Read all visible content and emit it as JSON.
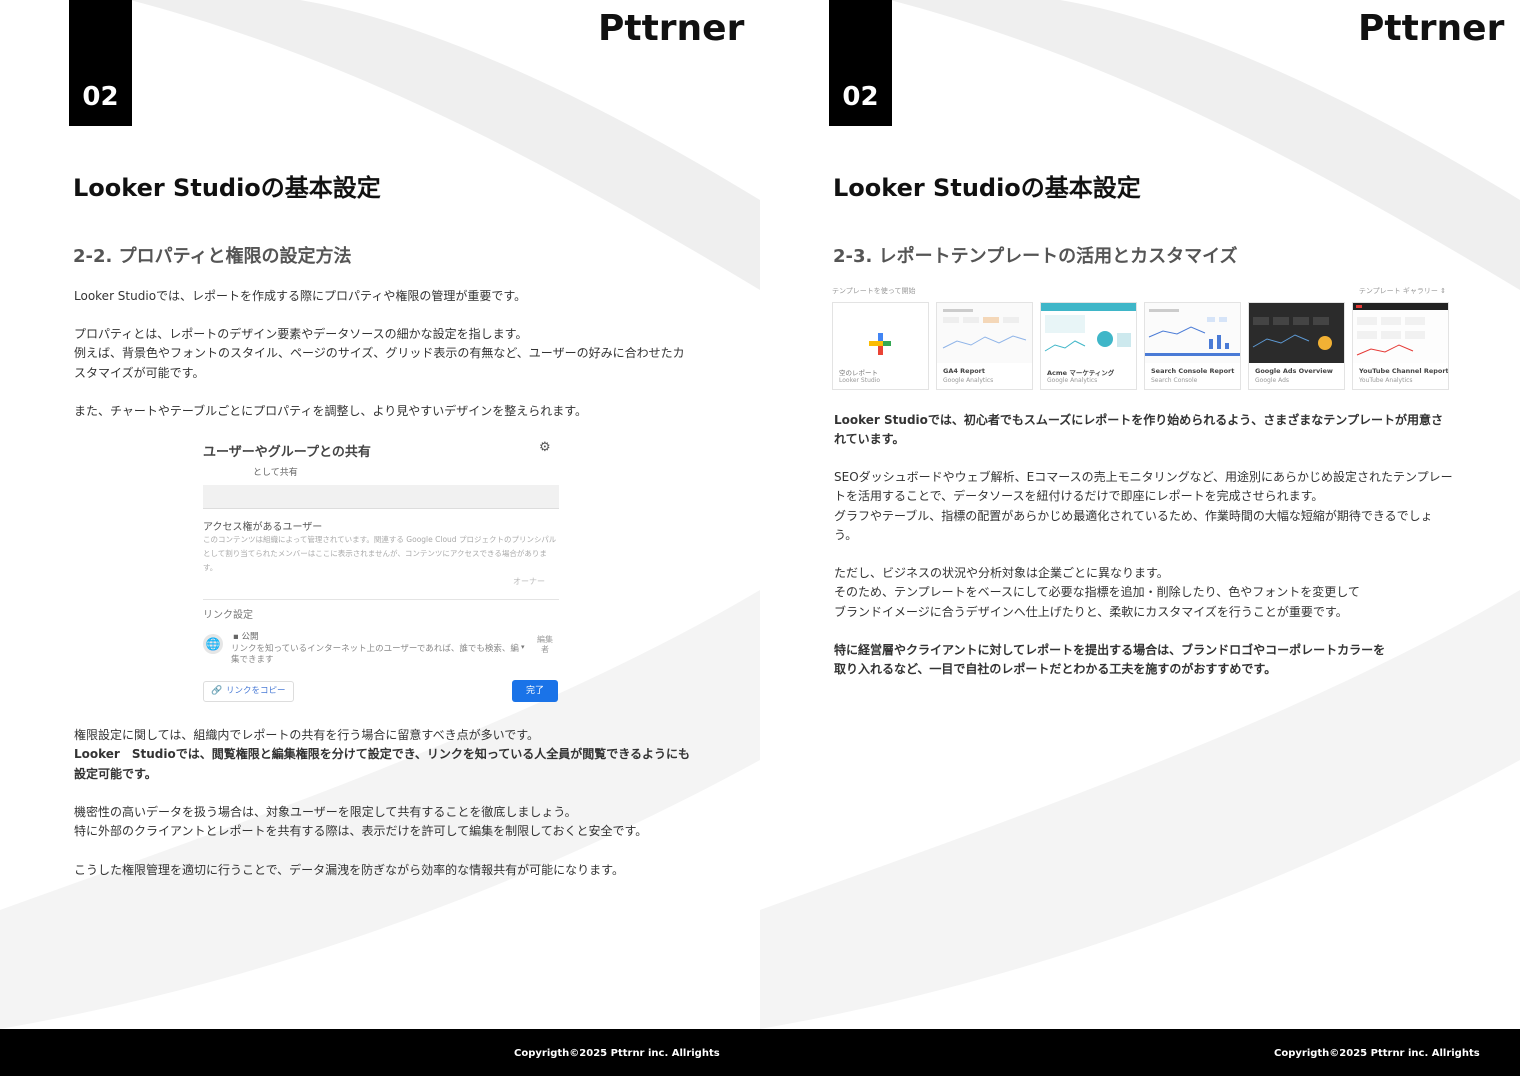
{
  "brand": {
    "logo_text": "Pttrner"
  },
  "left_page": {
    "chapter_number": "02",
    "title": "Looker Studioの基本設定",
    "section_title": "2-2. プロパティと権限の設定方法",
    "para1": "Looker Studioでは、レポートを作成する際にプロパティや権限の管理が重要です。",
    "para2": "プロパティとは、レポートのデザイン要素やデータソースの細かな設定を指します。\n例えば、背景色やフォントのスタイル、ページのサイズ、グリッド表示の有無など、ユーザーの好みに合わせたカスタマイズが可能です。",
    "para3": "また、チャートやテーブルごとにプロパティを調整し、より見やすいデザインを整えられます。",
    "para4_normal": "権限設定に関しては、組織内でレポートの共有を行う場合に留意すべき点が多いです。",
    "para4_bold": "Looker　Studioでは、閲覧権限と編集権限を分けて設定でき、リンクを知っている人全員が閲覧できるようにも設定可能です。",
    "para5": "機密性の高いデータを扱う場合は、対象ユーザーを限定して共有することを徹底しましょう。\n特に外部のクライアントとレポートを共有する際は、表示だけを許可して編集を制限しておくと安全です。",
    "para6": "こうした権限管理を適切に行うことで、データ漏洩を防ぎながら効率的な情報共有が可能になります。",
    "share_dialog": {
      "title": "ユーザーやグループとの共有",
      "share_as": "として共有",
      "access_heading": "アクセス権があるユーザー",
      "access_note": "このコンテンツは組織によって管理されています。関連する Google Cloud プロジェクトのプリンシパルとして割り当てられたメンバーはここに表示されませんが、コンテンツにアクセスできる場合があります。",
      "owner_label": "オーナー",
      "link_settings": "リンク設定",
      "visibility": "公開",
      "visibility_desc": "リンクを知っているインターネット上のユーザーであれば、誰でも検索、編集できます",
      "role": "編集者",
      "copy_link": "リンクをコピー",
      "done": "完了"
    },
    "copyright": "Copyrigth©2025 Pttrnr inc. Allrights"
  },
  "right_page": {
    "chapter_number": "02",
    "title": "Looker Studioの基本設定",
    "section_title": "2-3. レポートテンプレートの活用とカスタマイズ",
    "gallery": {
      "header_left": "テンプレートを使って開始",
      "header_right": "テンプレート ギャラリー ⇕",
      "cards": [
        {
          "name": "空のレポート",
          "source": "Looker Studio"
        },
        {
          "name": "GA4 Report",
          "source": "Google Analytics"
        },
        {
          "name": "Acme マーケティング",
          "source": "Google Analytics"
        },
        {
          "name": "Search Console Report",
          "source": "Search Console"
        },
        {
          "name": "Google Ads Overview",
          "source": "Google Ads"
        },
        {
          "name": "YouTube Channel Report",
          "source": "YouTube Analytics"
        }
      ]
    },
    "para1_bold": "Looker Studioでは、初心者でもスムーズにレポートを作り始められるよう、さまざまなテンプレートが用意されています。",
    "para2": "SEOダッシュボードやウェブ解析、Eコマースの売上モニタリングなど、用途別にあらかじめ設定されたテンプレートを活用することで、データソースを紐付けるだけで即座にレポートを完成させられます。\nグラフやテーブル、指標の配置があらかじめ最適化されているため、作業時間の大幅な短縮が期待できるでしょう。",
    "para3": "ただし、ビジネスの状況や分析対象は企業ごとに異なります。\nそのため、テンプレートをベースにして必要な指標を追加・削除したり、色やフォントを変更して\nブランドイメージに合うデザインへ仕上げたりと、柔軟にカスタマイズを行うことが重要です。",
    "para4_bold": "特に経営層やクライアントに対してレポートを提出する場合は、ブランドロゴやコーポレートカラーを\n取り入れるなど、一目で自社のレポートだとわかる工夫を施すのがおすすめです。",
    "copyright": "Copyrigth©2025 Pttrnr inc. Allrights"
  },
  "colors": {
    "accent_black": "#000000",
    "button_blue": "#1a73e8",
    "link_blue": "#4a7bd6"
  }
}
